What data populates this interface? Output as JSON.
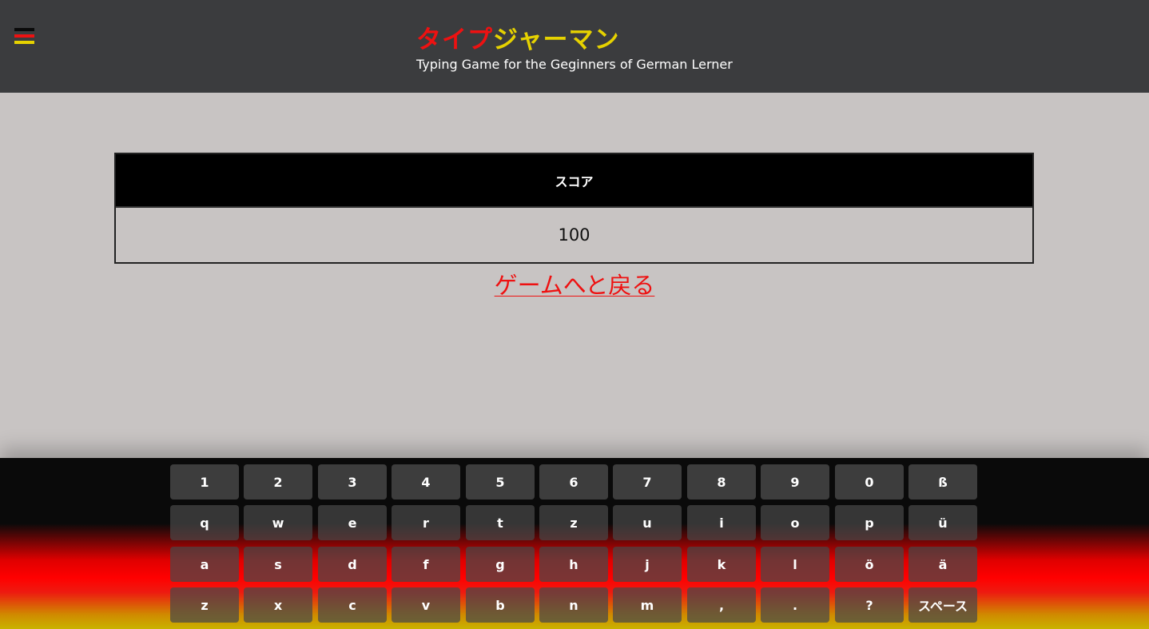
{
  "header": {
    "title_red": "タイプ",
    "title_yellow": "ジャーマン",
    "subtitle": "Typing Game for the Geginners of German Lerner"
  },
  "score": {
    "label": "スコア",
    "value": "100"
  },
  "back_link": "ゲームへと戻る",
  "keyboard": {
    "rows": [
      [
        "1",
        "2",
        "3",
        "4",
        "5",
        "6",
        "7",
        "8",
        "9",
        "0",
        "ß"
      ],
      [
        "q",
        "w",
        "e",
        "r",
        "t",
        "z",
        "u",
        "i",
        "o",
        "p",
        "ü"
      ],
      [
        "a",
        "s",
        "d",
        "f",
        "g",
        "h",
        "j",
        "k",
        "l",
        "ö",
        "ä"
      ],
      [
        "z",
        "x",
        "c",
        "v",
        "b",
        "n",
        "m",
        ",",
        ".",
        "?",
        "スペース"
      ]
    ]
  },
  "colors": {
    "header_bg": "#3b3c3e",
    "body_bg": "#c8c4c3",
    "german_black": "#0a0a0a",
    "german_red": "#ee1111",
    "german_gold": "#e6d200"
  }
}
